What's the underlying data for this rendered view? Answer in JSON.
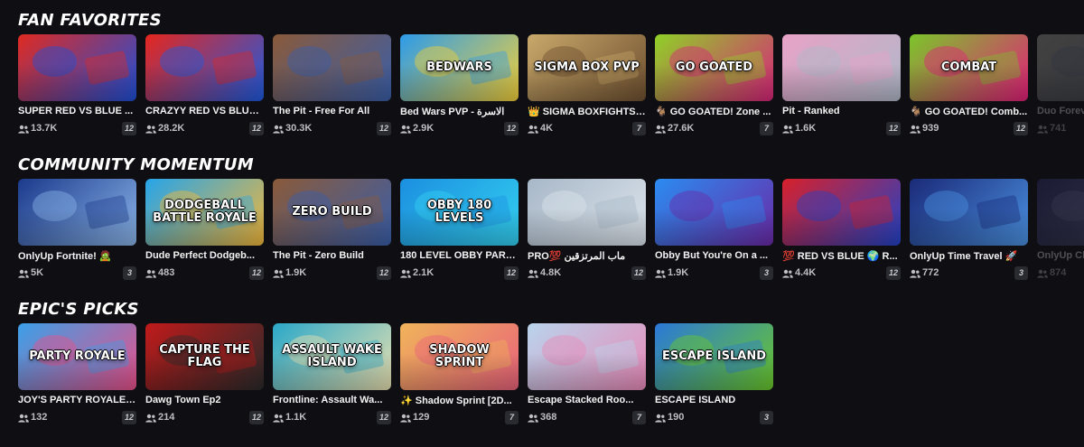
{
  "colors": {
    "background": "#0f0f13",
    "text": "#ffffff",
    "muted": "#bdbdc4",
    "badge_bg": "#2a2a31"
  },
  "sections": [
    {
      "title": "FAN FAVORITES",
      "cards": [
        {
          "title": "SUPER RED VS BLUE ...",
          "players": "13.7K",
          "badge": "12",
          "thumb_label": "",
          "colors": [
            "#e02a20",
            "#1e4fd8"
          ]
        },
        {
          "title": "CRAZYY RED VS BLUE ...",
          "players": "28.2K",
          "badge": "12",
          "thumb_label": "",
          "colors": [
            "#e6261d",
            "#1d5ae0"
          ]
        },
        {
          "title": "The Pit - Free For All",
          "players": "30.3K",
          "badge": "12",
          "thumb_label": "",
          "colors": [
            "#8a5a3a",
            "#3a5ea8"
          ]
        },
        {
          "title": "Bed Wars PVP - الاسرة",
          "players": "2.9K",
          "badge": "12",
          "thumb_label": "BEDWARS",
          "colors": [
            "#2c9bea",
            "#f2d03a"
          ]
        },
        {
          "title": "👑 SIGMA BOXFIGHTS ...",
          "players": "4K",
          "badge": "7",
          "thumb_label": "SIGMA  BOX PVP",
          "colors": [
            "#c9a86a",
            "#6e5030"
          ]
        },
        {
          "title": "🐐 GO GOATED! Zone ...",
          "players": "27.6K",
          "badge": "7",
          "thumb_label": "GO GOATED",
          "colors": [
            "#8fd126",
            "#d8247a"
          ]
        },
        {
          "title": "Pit - Ranked",
          "players": "1.6K",
          "badge": "12",
          "thumb_label": "",
          "colors": [
            "#e8a2c7",
            "#b0b8c8"
          ]
        },
        {
          "title": "🐐 GO GOATED! Comb...",
          "players": "939",
          "badge": "12",
          "thumb_label": "COMBAT",
          "colors": [
            "#7bc62a",
            "#e21f79"
          ]
        },
        {
          "title": "Duo Forev...",
          "players": "741",
          "badge": "",
          "thumb_label": "",
          "colors": [
            "#c8c6b8",
            "#8e96b0"
          ]
        }
      ]
    },
    {
      "title": "COMMUNITY MOMENTUM",
      "cards": [
        {
          "title": "OnlyUp Fortnite! 🧟",
          "players": "5K",
          "badge": "3",
          "thumb_label": "",
          "colors": [
            "#1b3a8c",
            "#8ab4e8"
          ]
        },
        {
          "title": "Dude Perfect Dodgeb...",
          "players": "483",
          "badge": "12",
          "thumb_label": "DODGEBALL BATTLE ROYALE",
          "colors": [
            "#25a4ea",
            "#f2b73a"
          ]
        },
        {
          "title": "The Pit - Zero Build",
          "players": "1.9K",
          "badge": "12",
          "thumb_label": "ZERO BUILD",
          "colors": [
            "#8a5a3a",
            "#3a5ea8"
          ]
        },
        {
          "title": "180 LEVEL OBBY PARK...",
          "players": "2.1K",
          "badge": "12",
          "thumb_label": "OBBY 180 LEVELS",
          "colors": [
            "#1c8fe0",
            "#33d0f0"
          ]
        },
        {
          "title": "PRO💯 ماب المرتزقين",
          "players": "4.8K",
          "badge": "12",
          "thumb_label": "",
          "colors": [
            "#a8b8c8",
            "#dce4ec"
          ]
        },
        {
          "title": "Obby But You're On a ...",
          "players": "1.9K",
          "badge": "3",
          "thumb_label": "",
          "colors": [
            "#2a8cf0",
            "#6a2aa8"
          ]
        },
        {
          "title": "💯 RED VS BLUE 🌍 R...",
          "players": "4.4K",
          "badge": "12",
          "thumb_label": "",
          "colors": [
            "#d8202a",
            "#2242c8"
          ]
        },
        {
          "title": "OnlyUp Time Travel 🚀",
          "players": "772",
          "badge": "3",
          "thumb_label": "",
          "colors": [
            "#1a2a78",
            "#4a90e0"
          ]
        },
        {
          "title": "OnlyUp Ch...",
          "players": "874",
          "badge": "",
          "thumb_label": "",
          "colors": [
            "#3a3a8a",
            "#9a9ae0"
          ]
        }
      ]
    },
    {
      "title": "EPIC'S PICKS",
      "cards": [
        {
          "title": "JOY'S PARTY ROYALE ...",
          "players": "132",
          "badge": "12",
          "thumb_label": "PARTY ROYALE",
          "colors": [
            "#3aa0e8",
            "#e8508a"
          ]
        },
        {
          "title": "Dawg Town Ep2",
          "players": "214",
          "badge": "12",
          "thumb_label": "CAPTURE THE FLAG",
          "colors": [
            "#c01a1a",
            "#2a2a2a"
          ]
        },
        {
          "title": "Frontline: Assault Wa...",
          "players": "1.1K",
          "badge": "12",
          "thumb_label": "ASSAULT WAKE ISLAND",
          "colors": [
            "#2aa8c8",
            "#e8e0b0"
          ]
        },
        {
          "title": "✨ Shadow Sprint [2D...",
          "players": "129",
          "badge": "7",
          "thumb_label": "SHADOW SPRINT",
          "colors": [
            "#f0b45a",
            "#e8627a"
          ]
        },
        {
          "title": "Escape Stacked Roo...",
          "players": "368",
          "badge": "7",
          "thumb_label": "",
          "colors": [
            "#b8d4ec",
            "#e88ab8"
          ]
        },
        {
          "title": "ESCAPE ISLAND",
          "players": "190",
          "badge": "3",
          "thumb_label": "ESCAPE ISLAND",
          "colors": [
            "#2a78d8",
            "#6ac82a"
          ]
        }
      ]
    }
  ]
}
